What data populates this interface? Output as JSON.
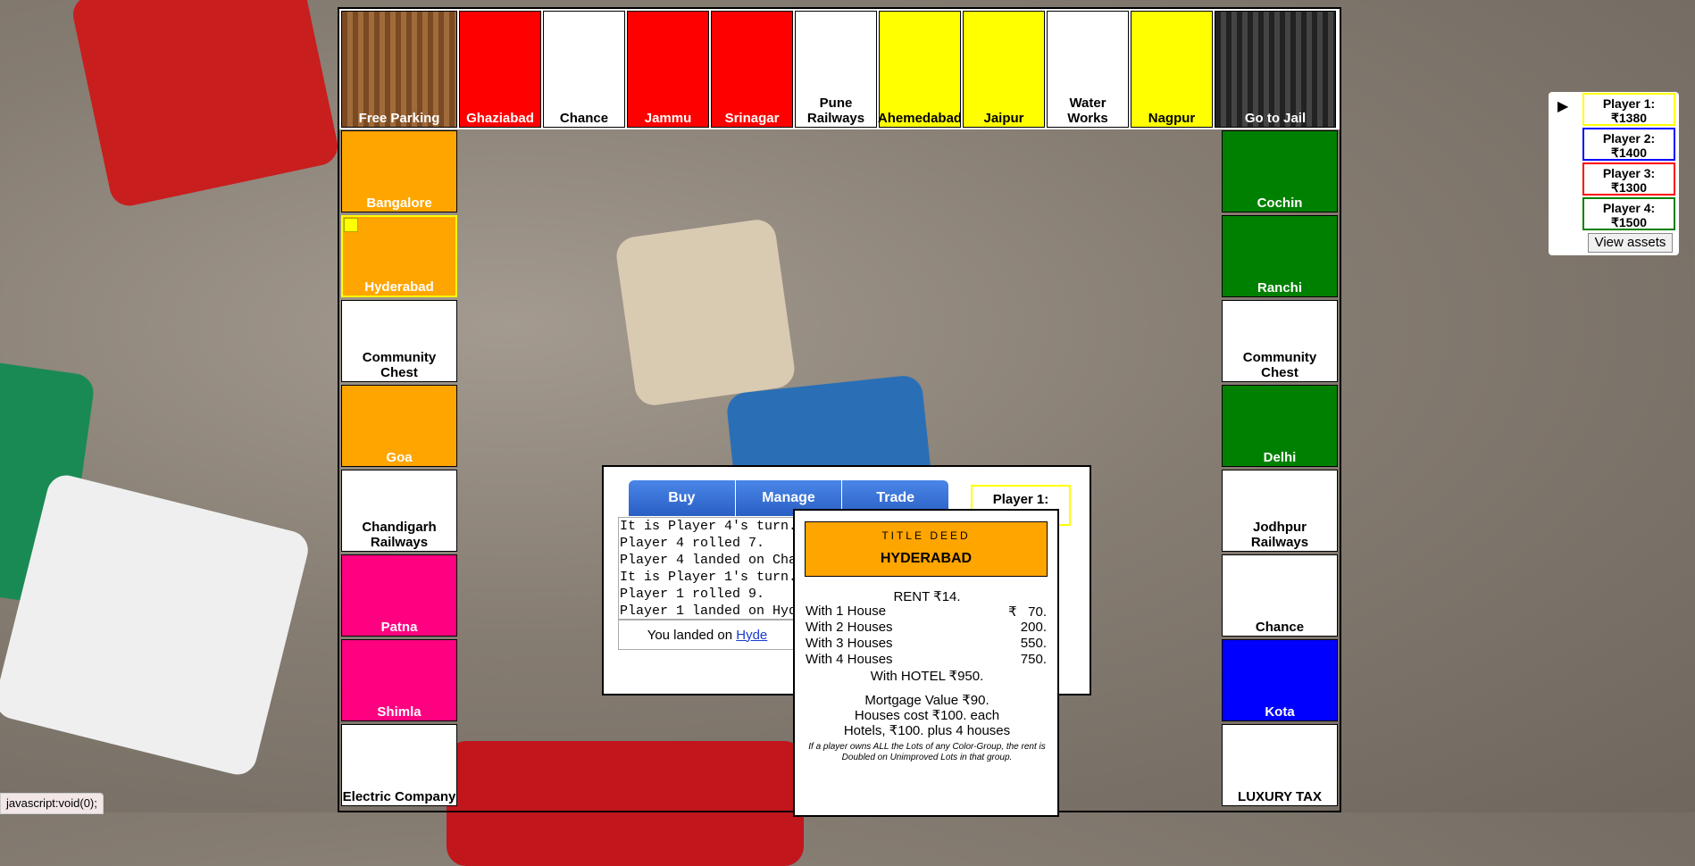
{
  "top_row": [
    {
      "name": "Free Parking",
      "color": "#8b5a2b",
      "text": "light"
    },
    {
      "name": "Ghaziabad",
      "color": "#ff0000",
      "text": "light"
    },
    {
      "name": "Chance",
      "color": "#ffffff",
      "text": "dark"
    },
    {
      "name": "Jammu",
      "color": "#ff0000",
      "text": "light"
    },
    {
      "name": "Srinagar",
      "color": "#ff0000",
      "text": "light"
    },
    {
      "name": "Pune Railways",
      "color": "#ffffff",
      "text": "dark"
    },
    {
      "name": "Ahemedabad",
      "color": "#ffff00",
      "text": "dark"
    },
    {
      "name": "Jaipur",
      "color": "#ffff00",
      "text": "dark"
    },
    {
      "name": "Water Works",
      "color": "#ffffff",
      "text": "dark"
    },
    {
      "name": "Nagpur",
      "color": "#ffff00",
      "text": "dark"
    },
    {
      "name": "Go to Jail",
      "color": "#333333",
      "text": "light"
    }
  ],
  "left_col": [
    {
      "name": "Bangalore",
      "color": "#ffa500",
      "text": "light"
    },
    {
      "name": "Hyderabad",
      "color": "#ffa500",
      "text": "light"
    },
    {
      "name": "Community Chest",
      "color": "#ffffff",
      "text": "dark"
    },
    {
      "name": "Goa",
      "color": "#ffa500",
      "text": "light"
    },
    {
      "name": "Chandigarh Railways",
      "color": "#ffffff",
      "text": "dark"
    },
    {
      "name": "Patna",
      "color": "#ff0080",
      "text": "light"
    },
    {
      "name": "Shimla",
      "color": "#ff0080",
      "text": "light"
    },
    {
      "name": "Electric Company",
      "color": "#ffffff",
      "text": "dark"
    }
  ],
  "right_col": [
    {
      "name": "Cochin",
      "color": "#008000",
      "text": "light"
    },
    {
      "name": "Ranchi",
      "color": "#008000",
      "text": "light"
    },
    {
      "name": "Community Chest",
      "color": "#ffffff",
      "text": "dark"
    },
    {
      "name": "Delhi",
      "color": "#008000",
      "text": "light"
    },
    {
      "name": "Jodhpur Railways",
      "color": "#ffffff",
      "text": "dark"
    },
    {
      "name": "Chance",
      "color": "#ffffff",
      "text": "dark"
    },
    {
      "name": "Kota",
      "color": "#0000ff",
      "text": "light"
    },
    {
      "name": "LUXURY TAX",
      "color": "#ffffff",
      "text": "dark"
    }
  ],
  "tabs": [
    "Buy",
    "Manage",
    "Trade"
  ],
  "log": [
    "It is Player 4's turn.",
    "Player 4 rolled 7.",
    "Player 4 landed on Cha",
    "It is Player 1's turn.",
    "Player 1 rolled 9.",
    "Player 1 landed on Hyd"
  ],
  "landed": {
    "prefix": "You landed on ",
    "link": "Hyde"
  },
  "current_player_label": "Player 1:",
  "deed": {
    "title_small": "TITLE DEED",
    "name": "HYDERABAD",
    "color": "#ffa500",
    "rent": "RENT ₹14.",
    "rows": [
      {
        "label": "With 1 House",
        "value": "₹   70."
      },
      {
        "label": "With 2 Houses",
        "value": "200."
      },
      {
        "label": "With 3 Houses",
        "value": "550."
      },
      {
        "label": "With 4 Houses",
        "value": "750."
      }
    ],
    "hotel": "With HOTEL ₹950.",
    "mortgage": "Mortgage Value ₹90.",
    "houses_cost": "Houses cost ₹100. each",
    "hotels_cost": "Hotels, ₹100. plus 4 houses",
    "note": "If a player owns ALL the Lots of any Color-Group, the rent is Doubled on Unimproved Lots in that group."
  },
  "players": [
    {
      "label": "Player 1:",
      "money": "₹1380",
      "color": "#ffff00"
    },
    {
      "label": "Player 2:",
      "money": "₹1400",
      "color": "#0000ff"
    },
    {
      "label": "Player 3:",
      "money": "₹1300",
      "color": "#ff0000"
    },
    {
      "label": "Player 4:",
      "money": "₹1500",
      "color": "#008000"
    }
  ],
  "turn_marker": "▶",
  "view_assets": "View assets",
  "status_bar": "javascript:void(0);"
}
